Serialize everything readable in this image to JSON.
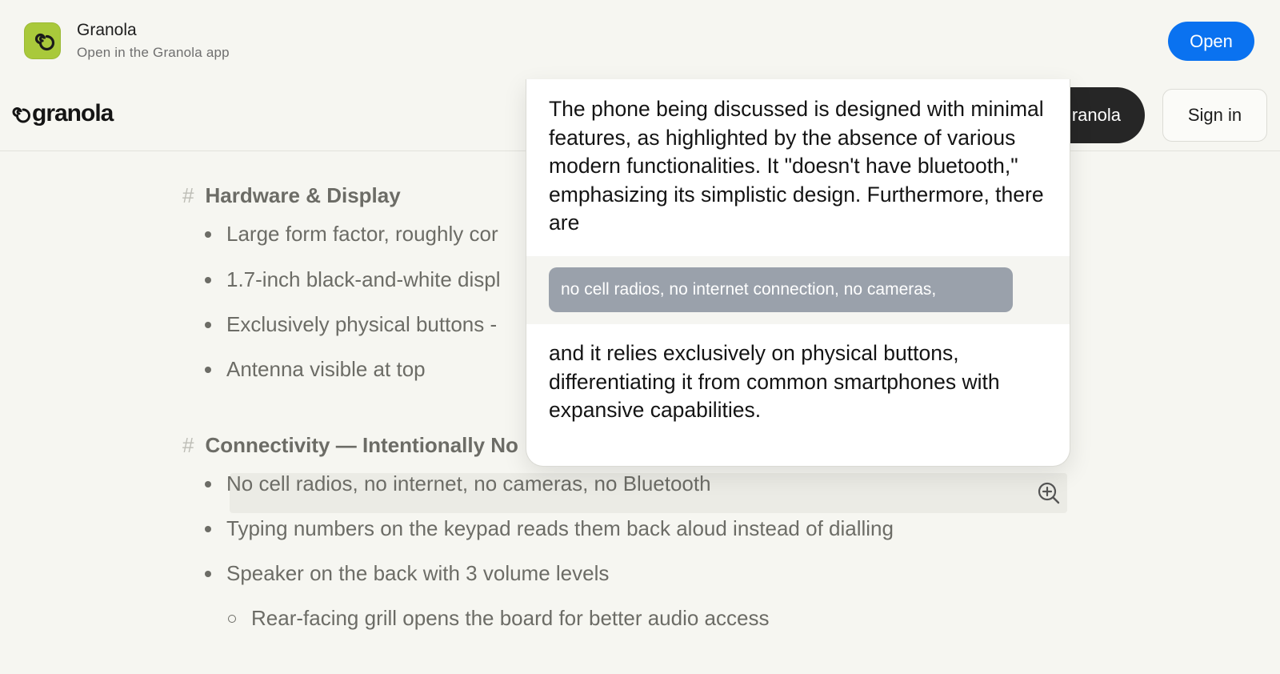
{
  "app_banner": {
    "app_name": "Granola",
    "subtitle": "Open in the Granola app",
    "open_label": "Open",
    "icon": "granola-swirl-icon",
    "accent_color": "#0a72f0",
    "icon_color": "#a9c93b"
  },
  "header": {
    "logo_text": "granola",
    "dark_button_label": "ranola",
    "sign_in_label": "Sign in"
  },
  "notes": {
    "sections": [
      {
        "heading": "Hardware & Display",
        "bullets": [
          "Large form factor, roughly cor",
          "1.7-inch black-and-white displ",
          "Exclusively physical buttons -",
          "Antenna visible at top"
        ]
      },
      {
        "heading": "Connectivity — Intentionally No",
        "bullets": [
          "No cell radios, no internet, no cameras, no Bluetooth",
          "Typing numbers on the keypad reads them back aloud instead of dialling",
          "Speaker on the back with 3 volume levels"
        ],
        "sub_bullets": [
          "Rear-facing grill opens the board for better audio access"
        ]
      }
    ],
    "zoom_icon": "zoom-in-icon"
  },
  "popup": {
    "text_before": "The phone being discussed is designed with minimal features, as highlighted by the absence of various modern functionalities. It \"doesn't have bluetooth,\" emphasizing its simplistic design. Furthermore, there are",
    "quote": "no cell radios, no internet connection, no cameras,",
    "text_after": "and it relies exclusively on physical buttons, differentiating it from common smartphones with expansive capabilities."
  }
}
